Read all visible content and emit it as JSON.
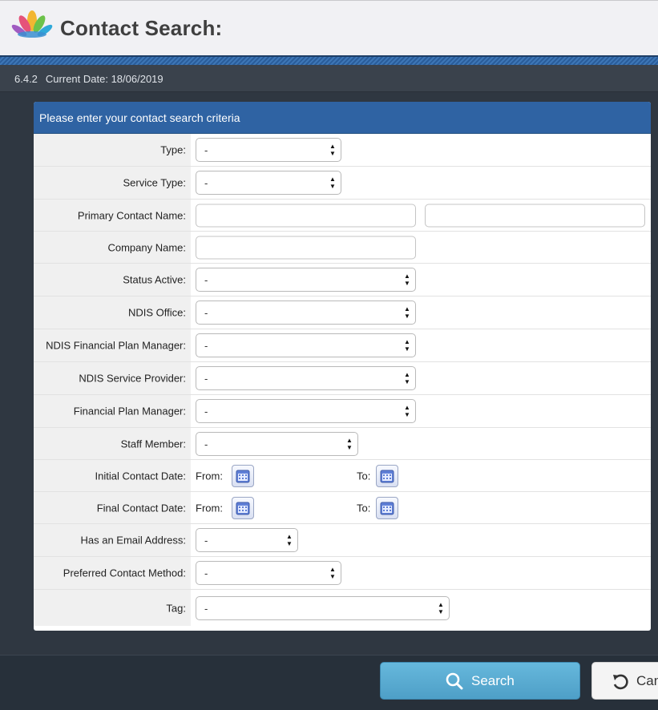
{
  "header": {
    "title": "Contact Search:"
  },
  "version_bar": {
    "version": "6.4.2",
    "current_date": "Current Date: 18/06/2019"
  },
  "panel": {
    "heading": "Please enter your contact search criteria",
    "fields": {
      "type": {
        "label": "Type:",
        "value": "-"
      },
      "service_type": {
        "label": "Service Type:",
        "value": "-"
      },
      "primary_contact_name": {
        "label": "Primary Contact Name:",
        "first": "",
        "last": ""
      },
      "company_name": {
        "label": "Company Name:",
        "value": ""
      },
      "status_active": {
        "label": "Status Active:",
        "value": "-"
      },
      "ndis_office": {
        "label": "NDIS Office:",
        "value": "-"
      },
      "ndis_financial_plan_manager": {
        "label": "NDIS Financial Plan Manager:",
        "value": "-"
      },
      "ndis_service_provider": {
        "label": "NDIS Service Provider:",
        "value": "-"
      },
      "financial_plan_manager": {
        "label": "Financial Plan Manager:",
        "value": "-"
      },
      "staff_member": {
        "label": "Staff Member:",
        "value": "-"
      },
      "initial_contact_date": {
        "label": "Initial Contact Date:",
        "from_label": "From:",
        "to_label": "To:"
      },
      "final_contact_date": {
        "label": "Final Contact Date:",
        "from_label": "From:",
        "to_label": "To:"
      },
      "has_email_address": {
        "label": "Has an Email Address:",
        "value": "-"
      },
      "preferred_contact_method": {
        "label": "Preferred Contact Method:",
        "value": "-"
      },
      "tag": {
        "label": "Tag:",
        "value": "-"
      }
    }
  },
  "footer": {
    "search_label": "Search",
    "cancel_label": "Cancel"
  },
  "icons": {
    "logo": "lotus-logo-icon",
    "calendar": "calendar-icon",
    "search": "search-icon",
    "cancel": "undo-icon"
  },
  "colors": {
    "panel_header": "#2f63a3",
    "search_button": "#5aaed6",
    "background": "#2f3741"
  }
}
